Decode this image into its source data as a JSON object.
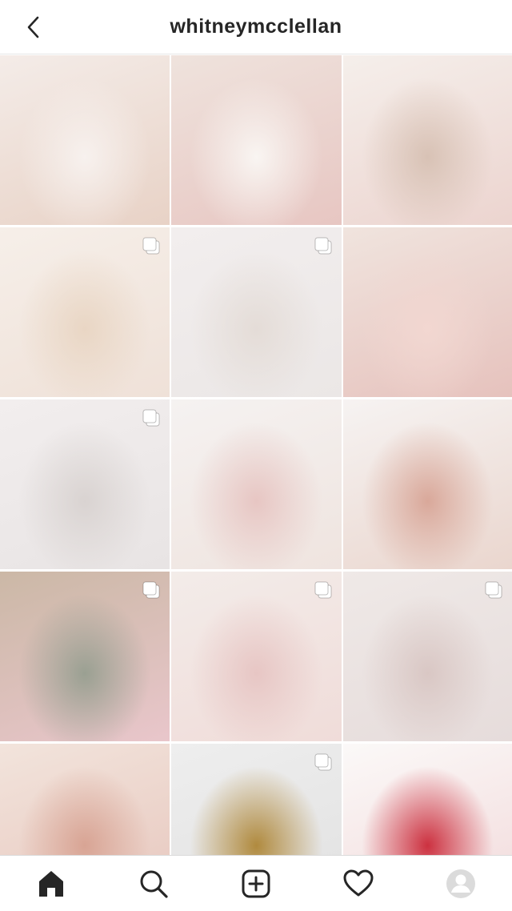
{
  "header": {
    "username": "whitneymcclellan",
    "back_icon": "chevron-left-icon"
  },
  "grid": {
    "posts": [
      {
        "id": "post-1",
        "multi": false,
        "colors": [
          "#f4ece8",
          "#e8d2c6",
          "#f7f1ee"
        ]
      },
      {
        "id": "post-2",
        "multi": false,
        "colors": [
          "#efe3dd",
          "#e7c6c2",
          "#f9f5f2"
        ]
      },
      {
        "id": "post-3",
        "multi": false,
        "colors": [
          "#f5efeb",
          "#ecd4cf",
          "#d8c2b5"
        ]
      },
      {
        "id": "post-4",
        "multi": true,
        "colors": [
          "#f6efe9",
          "#efe1d8",
          "#e9d6c4"
        ]
      },
      {
        "id": "post-5",
        "multi": true,
        "colors": [
          "#f2eeee",
          "#ebe7e6",
          "#e4dcd7"
        ]
      },
      {
        "id": "post-6",
        "multi": false,
        "colors": [
          "#f0e4de",
          "#e6c2bd",
          "#f2d7d1"
        ]
      },
      {
        "id": "post-7",
        "multi": true,
        "colors": [
          "#f2eeee",
          "#e8e4e4",
          "#d9d3d1"
        ]
      },
      {
        "id": "post-8",
        "multi": false,
        "colors": [
          "#f5f2f1",
          "#efe4df",
          "#e7c6c3"
        ]
      },
      {
        "id": "post-9",
        "multi": false,
        "colors": [
          "#f6f3f2",
          "#ead6ce",
          "#d9a89a"
        ]
      },
      {
        "id": "post-10",
        "multi": true,
        "colors": [
          "#cbb8a6",
          "#e9c6cb",
          "#9aa092"
        ]
      },
      {
        "id": "post-11",
        "multi": true,
        "colors": [
          "#f3ece9",
          "#f0dcd9",
          "#e7c6c4"
        ]
      },
      {
        "id": "post-12",
        "multi": true,
        "colors": [
          "#efe9e7",
          "#e6dcdb",
          "#d9c7c4"
        ]
      },
      {
        "id": "post-13",
        "multi": false,
        "colors": [
          "#f2e4dc",
          "#e7c6bd",
          "#d8a494"
        ]
      },
      {
        "id": "post-14",
        "multi": true,
        "colors": [
          "#eeeeee",
          "#e1e1e1",
          "#b08a3e"
        ]
      },
      {
        "id": "post-15",
        "multi": false,
        "colors": [
          "#fbf9f8",
          "#f2d9da",
          "#cc3140"
        ]
      }
    ]
  },
  "tabs": [
    {
      "name": "tab-home",
      "icon": "home-icon",
      "active": true
    },
    {
      "name": "tab-search",
      "icon": "search-icon",
      "active": false
    },
    {
      "name": "tab-new-post",
      "icon": "plus-square-icon",
      "active": false
    },
    {
      "name": "tab-activity",
      "icon": "heart-icon",
      "active": false
    },
    {
      "name": "tab-profile",
      "icon": "avatar-icon",
      "active": false
    }
  ]
}
